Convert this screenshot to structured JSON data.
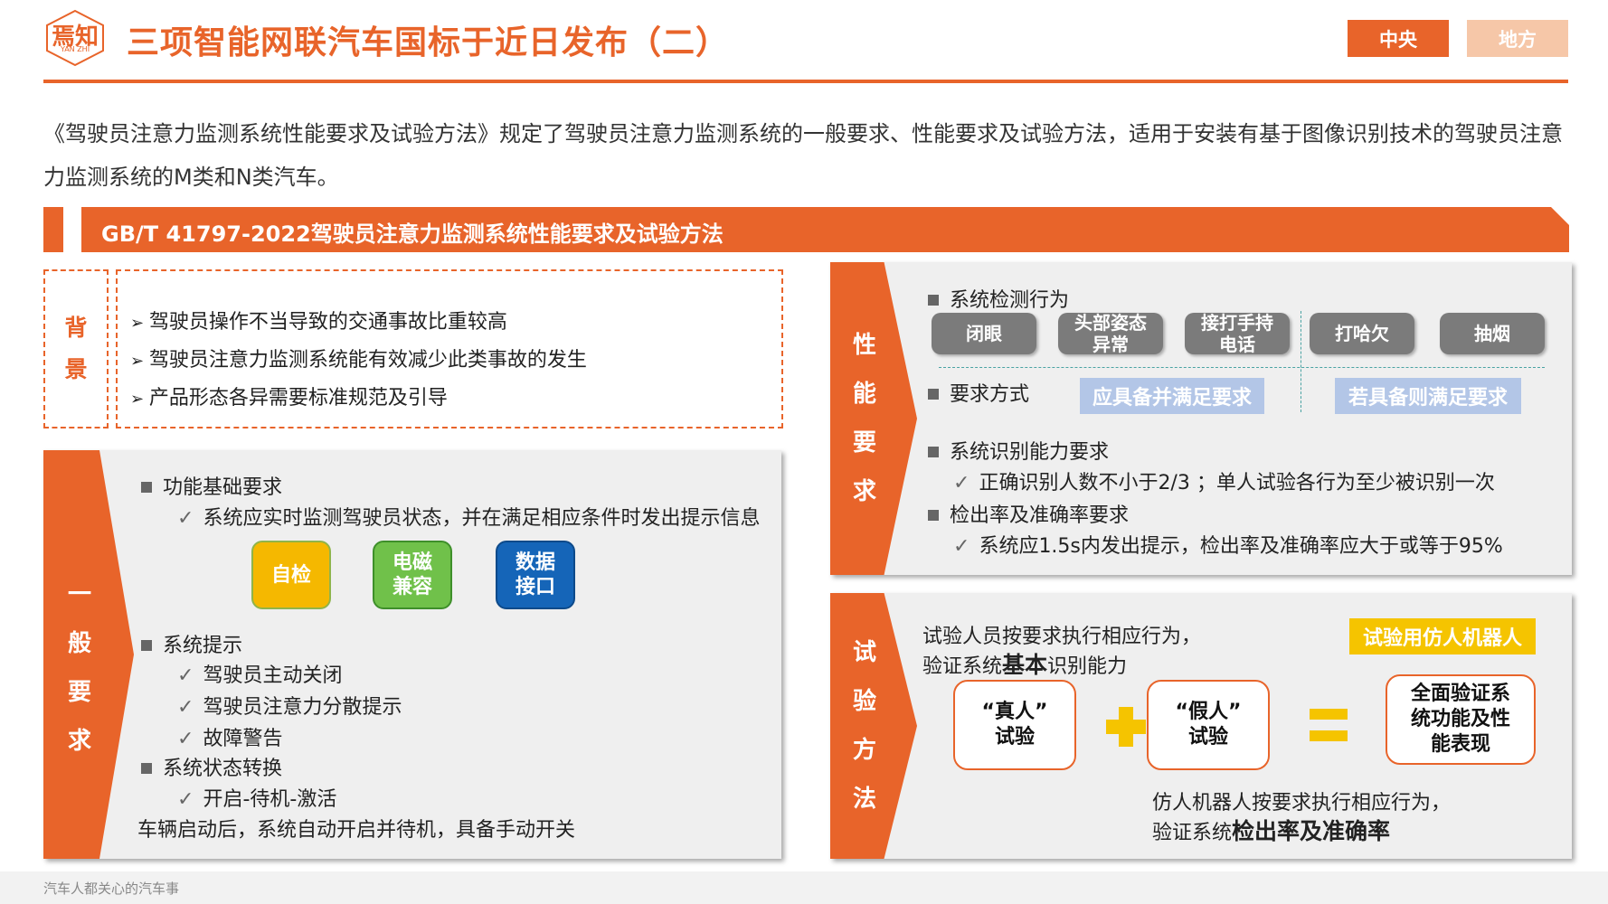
{
  "header": {
    "title": "三项智能网联汽车国标于近日发布（二）",
    "logo_text": "焉知",
    "logo_sub": "YAN ZHI",
    "tab_active": "中央",
    "tab_inactive": "地方"
  },
  "intro": "《驾驶员注意力监测系统性能要求及试验方法》规定了驾驶员注意力监测系统的一般要求、性能要求及试验方法，适用于安装有基于图像识别技术的驾驶员注意力监测系统的M类和N类汽车。",
  "banner": "GB/T 41797-2022驾驶员注意力监测系统性能要求及试验方法",
  "background": {
    "label": [
      "背",
      "景"
    ],
    "items": [
      "驾驶员操作不当导致的交通事故比重较高",
      "驾驶员注意力监测系统能有效减少此类事故的发生",
      "产品形态各异需要标准规范及引导"
    ]
  },
  "general": {
    "label": [
      "一",
      "般",
      "要",
      "求"
    ],
    "h1": "功能基础要求",
    "c1": "系统应实时监测驾驶员状态，并在满足相应条件时发出提示信息",
    "badges": [
      {
        "text": "自检",
        "color": "#f5b800"
      },
      {
        "text": "电磁\n兼容",
        "color": "#70c14a"
      },
      {
        "text": "数据\n接口",
        "color": "#1565b8"
      }
    ],
    "h2": "系统提示",
    "c2": [
      "驾驶员主动关闭",
      "驾驶员注意力分散提示",
      "故障警告"
    ],
    "h3": "系统状态转换",
    "c3": "开启-待机-激活",
    "note": "车辆启动后，系统自动开启并待机，具备手动开关"
  },
  "perf": {
    "label": [
      "性",
      "能",
      "要",
      "求"
    ],
    "h1": "系统检测行为",
    "behaviors": [
      "闭眼",
      "头部姿态\n异常",
      "接打手持\n电话",
      "打哈欠",
      "抽烟"
    ],
    "h2": "要求方式",
    "req1": "应具备并满足要求",
    "req2": "若具备则满足要求",
    "h3": "系统识别能力要求",
    "c3": "正确识别人数不小于2/3 ；单人试验各行为至少被识别一次",
    "h4": "检出率及准确率要求",
    "c4": "系统应1.5s内发出提示，检出率及准确率应大于或等于95%"
  },
  "test": {
    "label": [
      "试",
      "验",
      "方",
      "法"
    ],
    "line1": "试验人员按要求执行相应行为，",
    "line2a": "验证系统",
    "line2b": "基本",
    "line2c": "识别能力",
    "robot": "试验用仿人机器人",
    "real": "“真人”\n试验",
    "fake": "“假人”\n试验",
    "result": "全面验证系\n统功能及性\n能表现",
    "bottom1": "仿人机器人按要求执行相应行为，",
    "bottom2a": "验证系统",
    "bottom2b": "检出率及准确率"
  },
  "footer": "汽车人都关心的汽车事",
  "colors": {
    "accent": "#e8642a",
    "tab_inactive": "#f6c7a8"
  }
}
